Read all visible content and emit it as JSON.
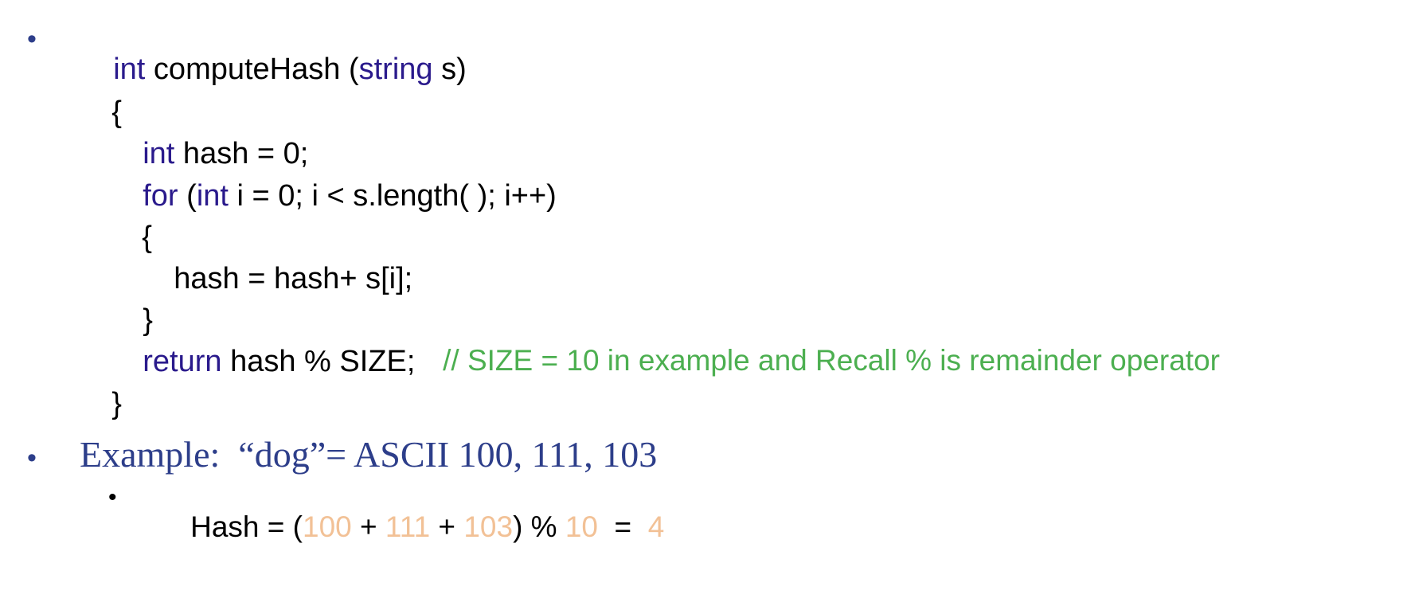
{
  "code": {
    "bullet": "•",
    "line1": {
      "kw1": "int",
      "p1": " computeHash (",
      "kw2": "string",
      "p2": " s)"
    },
    "line2": "{",
    "line3": {
      "kw": "int",
      "p": " hash = 0;"
    },
    "line4": {
      "kw1": "for",
      "p1": " (",
      "kw2": "int",
      "p2": " i = 0; i < s.length( ); i++)"
    },
    "line5": "{",
    "line6": "hash = hash+ s[i];",
    "line7": "}",
    "line8": {
      "kw": "return",
      "p": " hash % SIZE;",
      "comment": "// SIZE = 10 in example and Recall % is remainder operator"
    },
    "line9": "}"
  },
  "example": {
    "bullet": "•",
    "text": "Example:  “dog”= ASCII 100, 111, 103",
    "sub_bullet": "•",
    "hash": {
      "prefix": "Hash = (",
      "v1": "100",
      "plus1": " + ",
      "v2": "111",
      "plus2": " + ",
      "v3": "103",
      "mod": ") % ",
      "size": "10",
      "eq": "  =  ",
      "result": "4"
    }
  },
  "colors": {
    "keyword": "#2a1a8c",
    "comment": "#4caf50",
    "number": "#f2c196",
    "serif_text": "#2d3e8a"
  }
}
